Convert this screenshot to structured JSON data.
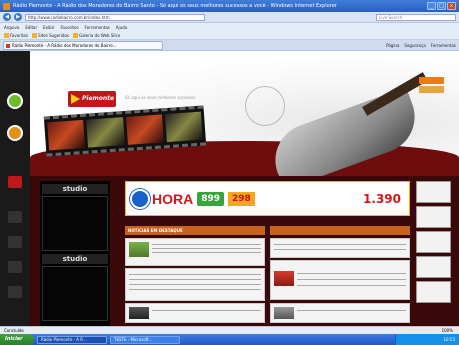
{
  "window": {
    "title": "Rádio Piemonte - A Rádio dos Moradores do Bairro Santo - Só aqui os seus melhores sucessos a você - Windows Internet Explorer",
    "minimize": "_",
    "maximize": "□",
    "close": "x"
  },
  "address": {
    "url": "http://www.radiobairro.com.br/index.htm",
    "search_placeholder": "Live Search"
  },
  "menu": [
    "Arquivo",
    "Editar",
    "Exibir",
    "Favoritos",
    "Ferramentas",
    "Ajuda"
  ],
  "favorites": [
    "Favoritos",
    "Sites Sugeridos",
    "Galeria do Web Slice"
  ],
  "tab": {
    "label": "Rádio Piemonte - A Rádio dos Moradores do Bairro..."
  },
  "toolbar_tools": [
    "Página",
    "Segurança",
    "Ferramentas"
  ],
  "page": {
    "logo_text": "Piemonte",
    "slogan": "Só aqui os seus melhores sucessos",
    "studio_label_1": "studio",
    "studio_label_2": "studio",
    "banner": {
      "hora": "HORA",
      "price_1": "899",
      "price_2": "298",
      "price_3": "1.390"
    },
    "news_heading": "NOTICIAS EM DESTAQUE"
  },
  "status": {
    "text": "Concluído",
    "zoom": "100%"
  },
  "taskbar": {
    "start": "Iniciar",
    "tasks": [
      "Rádio Piemonte - A R...",
      "TESTE - Microsoft..."
    ],
    "clock": "10:53"
  }
}
